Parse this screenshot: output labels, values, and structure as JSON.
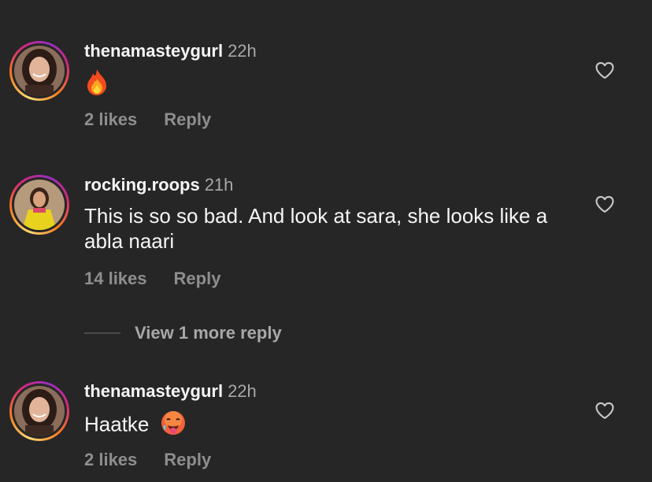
{
  "comments": [
    {
      "username": "thenamasteygurl",
      "time": "22h",
      "text": "",
      "emoji": "fire",
      "likes": "2 likes",
      "reply": "Reply"
    },
    {
      "username": "rocking.roops",
      "time": "21h",
      "text": "This is so so bad. And look at sara, she looks like a abla naari",
      "likes": "14 likes",
      "reply": "Reply"
    },
    {
      "username": "thenamasteygurl",
      "time": "22h",
      "text": "Haatke",
      "emoji": "hot-face",
      "likes": "2 likes",
      "reply": "Reply"
    }
  ],
  "view_more_label": "View 1 more reply",
  "icons": {
    "like": "heart-outline-icon"
  },
  "colors": {
    "background": "#262626",
    "text": "#f5f5f5",
    "secondary": "#a8a8a8"
  }
}
